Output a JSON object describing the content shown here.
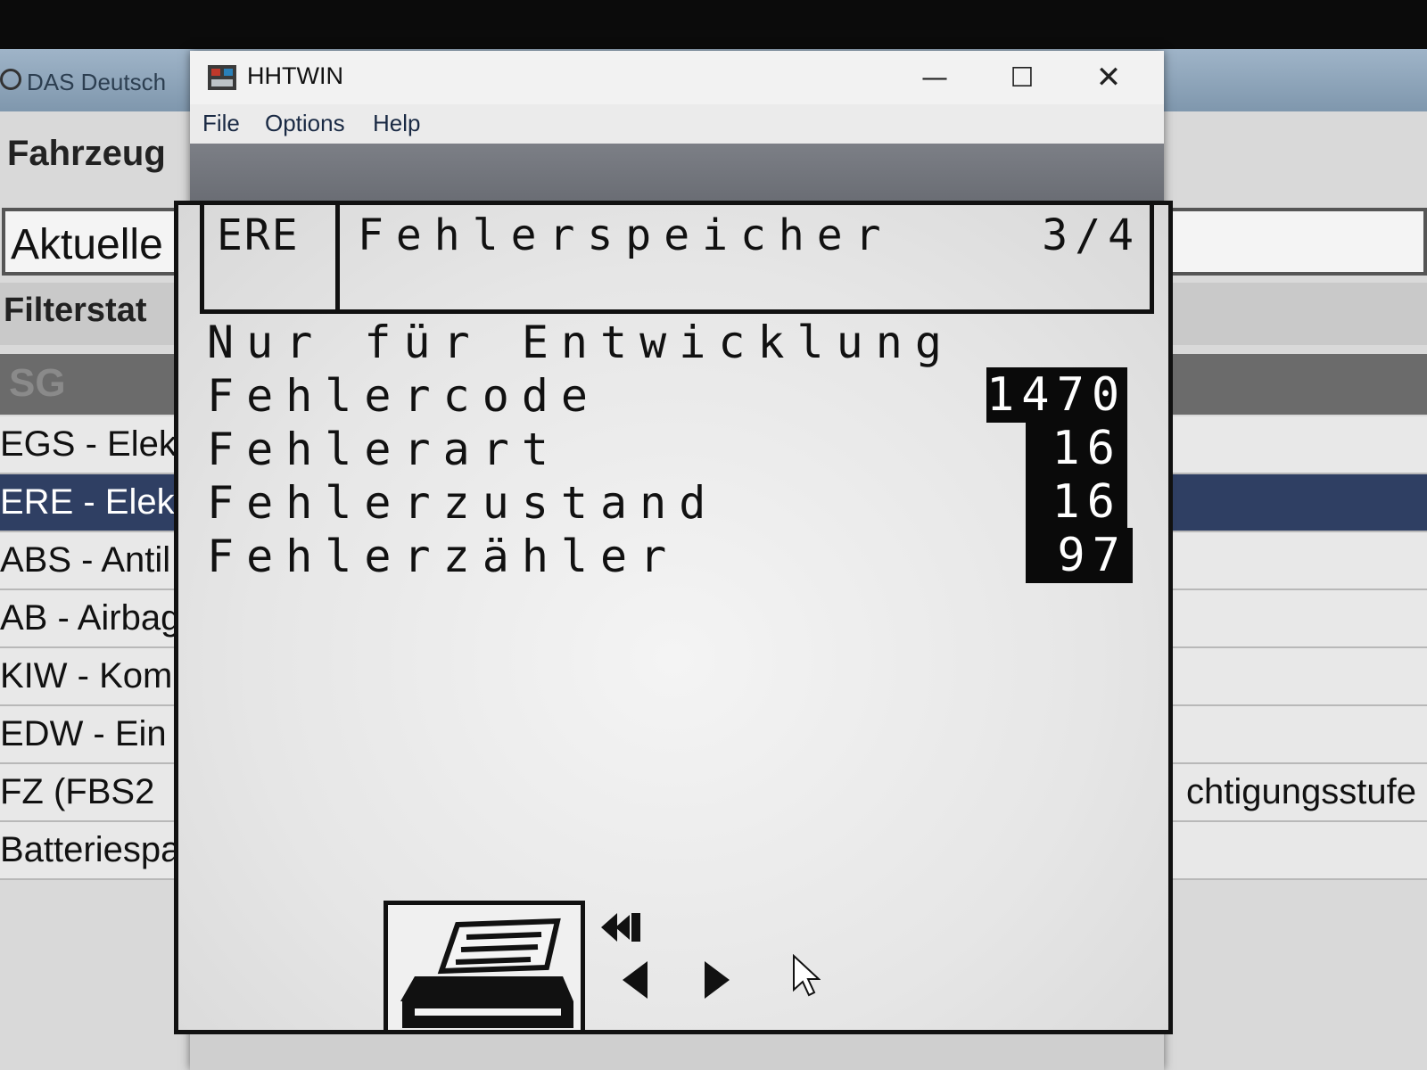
{
  "background_app": {
    "title": "DAS Deutsch",
    "heading": "Fahrzeug",
    "dropdown_value": "Aktuelle",
    "filter_label": "Filterstat",
    "list_header": "SG",
    "list_items": [
      {
        "label": "EGS - Elek"
      },
      {
        "label": "ERE - Elek"
      },
      {
        "label": "ABS - Antil"
      },
      {
        "label": "AB - Airbag"
      },
      {
        "label": "KIW - Kom"
      },
      {
        "label": "EDW - Ein"
      },
      {
        "label": "FZ (FBS2"
      },
      {
        "label": "Batteriespa"
      }
    ],
    "right_text": "chtigungsstufe"
  },
  "window": {
    "title": "HHTWIN",
    "menu": {
      "file": "File",
      "options": "Options",
      "help": "Help"
    }
  },
  "screen": {
    "module": "ERE",
    "title": "Fehlerspeicher",
    "page": "3/4",
    "subtitle": "Nur für Entwicklung",
    "rows": [
      {
        "label": "Fehlercode",
        "value": "1470"
      },
      {
        "label": "Fehlerart",
        "value": "16"
      },
      {
        "label": "Fehlerzustand",
        "value": "16"
      },
      {
        "label": "Fehlerzähler",
        "value": "97"
      }
    ]
  }
}
